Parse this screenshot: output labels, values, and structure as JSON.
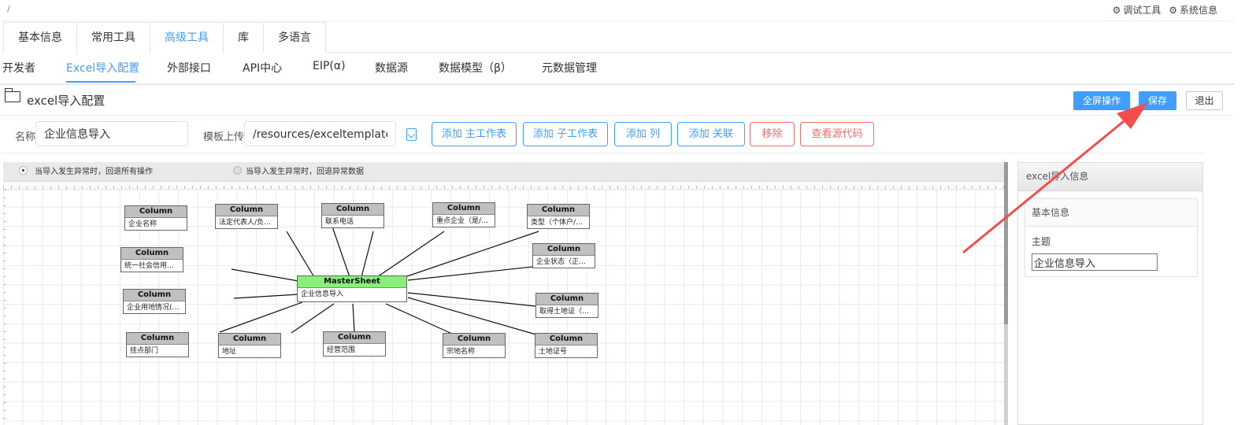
{
  "topbar": {
    "breadcrumb": "/",
    "debug_tool": "调试工具",
    "system_info": "系统信息"
  },
  "main_tabs": [
    {
      "label": "基本信息",
      "active": false
    },
    {
      "label": "常用工具",
      "active": false
    },
    {
      "label": "高级工具",
      "active": true
    },
    {
      "label": "库",
      "active": false
    },
    {
      "label": "多语言",
      "active": false
    }
  ],
  "sub_tabs": [
    {
      "label": "开发者",
      "active": false
    },
    {
      "label": "Excel导入配置",
      "active": true
    },
    {
      "label": "外部接口",
      "active": false
    },
    {
      "label": "API中心",
      "active": false
    },
    {
      "label": "EIP(α)",
      "active": false
    },
    {
      "label": "数据源",
      "active": false
    },
    {
      "label": "数据模型（β）",
      "active": false
    },
    {
      "label": "元数据管理",
      "active": false
    }
  ],
  "page": {
    "title": "excel导入配置",
    "fullscreen_label": "全屏操作",
    "save_label": "保存",
    "exit_label": "退出"
  },
  "form": {
    "name_label": "名称",
    "name_value": "企业信息导入",
    "template_label": "模板上传",
    "template_value": "/resources/exceltemplate/企业信息导入.xlsx"
  },
  "actions": {
    "add_master": "添加 主工作表",
    "add_child": "添加 子工作表",
    "add_column": "添加 列",
    "add_relation": "添加 关联",
    "remove": "移除",
    "view_source": "查看源代码"
  },
  "options": {
    "rollback_all": "当导入发生异常时，回退所有操作",
    "rollback_error": "当导入发生异常时，回退异常数据",
    "selected": "rollback_all"
  },
  "diagram": {
    "master": {
      "header": "MasterSheet",
      "name": "企业信息导入"
    },
    "column_header": "Column",
    "columns": [
      "企业名称",
      "法定代表人/负责人",
      "联系电话",
      "重点企业（是/否）",
      "类型（个体户/企业）",
      "统一社会信用代码",
      "企业状态（正常/注销）",
      "企业用地情况(转让/租赁)",
      "取得土地证（是/否）",
      "挂点部门",
      "地址",
      "经营范围",
      "宗地名称",
      "土地证号"
    ]
  },
  "side_panel": {
    "title": "excel导入信息",
    "section": "基本信息",
    "subject_label": "主题",
    "subject_value": "企业信息导入"
  },
  "colors": {
    "accent": "#409eff",
    "danger": "#f56c6c",
    "master_header": "#88f07a",
    "annotation_arrow": "#f24e4e"
  },
  "icons": [
    "debug-icon",
    "gear-icon",
    "folder-icon",
    "upload-icon"
  ]
}
